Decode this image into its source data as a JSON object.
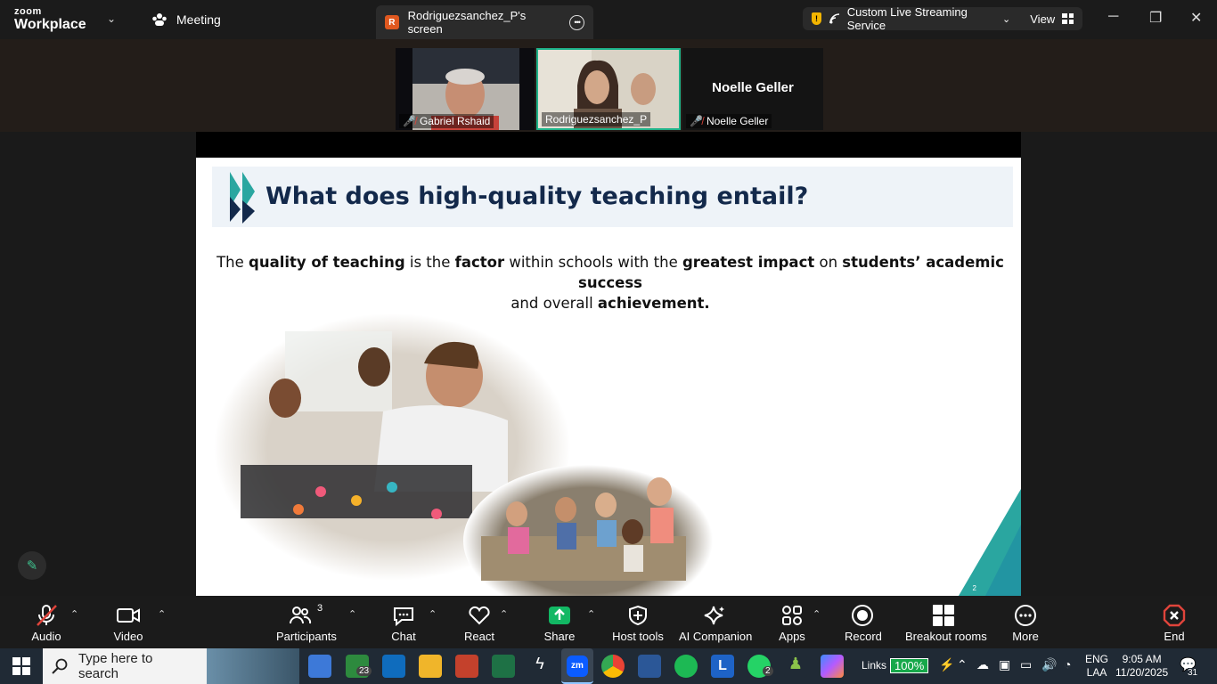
{
  "titlebar": {
    "brand_top": "zoom",
    "brand_bottom": "Workplace",
    "meeting_label": "Meeting",
    "screen_tab_badge": "R",
    "screen_tab_label": "Rodriguezsanchez_P's screen",
    "streaming_label": "Custom Live Streaming Service",
    "view_label": "View"
  },
  "participants": [
    {
      "name": "Gabriel Rshaid",
      "muted": true
    },
    {
      "name": "Rodriguezsanchez_P",
      "muted": false,
      "active": true
    },
    {
      "name": "Noelle Geller",
      "muted": true,
      "display_name": "Noelle Geller"
    }
  ],
  "slide": {
    "title": "What does high-quality teaching entail?",
    "body_parts": [
      "The ",
      "quality of teaching",
      " is the ",
      "factor",
      " within schools with the ",
      "greatest impact",
      " on ",
      "students’ academic success",
      " and overall ",
      "achievement."
    ],
    "page_number": "2"
  },
  "toolbar": {
    "audio": "Audio",
    "video": "Video",
    "participants": "Participants",
    "participants_count": "3",
    "chat": "Chat",
    "react": "React",
    "share": "Share",
    "host_tools": "Host tools",
    "ai_companion": "AI Companion",
    "apps": "Apps",
    "record": "Record",
    "breakout_rooms": "Breakout rooms",
    "more": "More",
    "end": "End"
  },
  "taskbar": {
    "search_placeholder": "Type here to search",
    "mail_badge": "23",
    "whatsapp_badge": "2",
    "links_label": "Links",
    "battery_percent": "100%",
    "language_top": "ENG",
    "language_bottom": "LAA",
    "time": "9:05 AM",
    "date": "11/20/2025",
    "notification_count": "31"
  },
  "colors": {
    "accent_green": "#1fb38a",
    "share_green": "#12b864",
    "end_red": "#e0443b",
    "slide_title": "#13294b",
    "teal": "#2aa6a0"
  }
}
